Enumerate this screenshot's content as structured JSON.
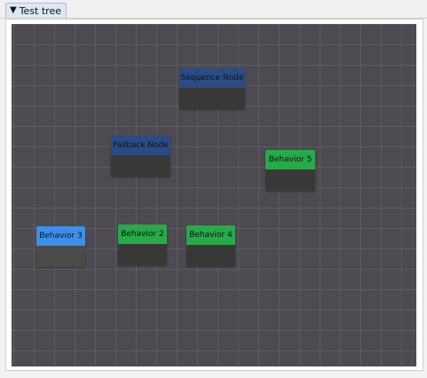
{
  "tab": {
    "icon": "filter-icon",
    "title": "Test tree"
  },
  "nodes": {
    "sequence": "Sequence Node",
    "fallback": "Fallback Node",
    "behavior5": "Behavior 5",
    "behavior3": "Behavior 3",
    "behavior2": "Behavior 2",
    "behavior4": "Behavior 4"
  },
  "colors": {
    "canvas_background": "#4d4b51",
    "composite_node": "#2b4b82",
    "behavior_node": "#2aa84a",
    "selected_node": "#3f8fe8",
    "node_body": "#383838"
  }
}
